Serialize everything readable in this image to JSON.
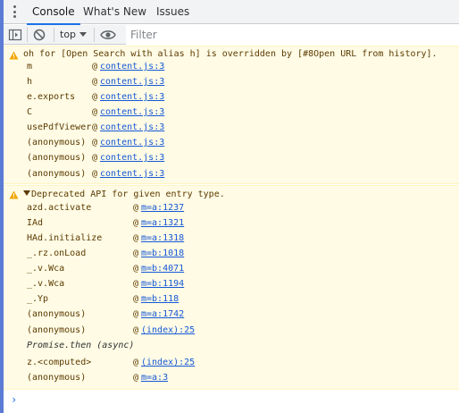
{
  "drawer": {
    "tabs": [
      {
        "label": "Console"
      },
      {
        "label": "What's New"
      },
      {
        "label": "Issues"
      }
    ]
  },
  "toolbar": {
    "context_label": "top",
    "filter_placeholder": "Filter"
  },
  "messages": [
    {
      "level": "warning",
      "text": "oh for [Open Search with alias h] is overridden by [#8Open URL from history].",
      "frames": [
        {
          "fn": "m",
          "at": "@",
          "link": "content.js:3"
        },
        {
          "fn": "h",
          "at": "@",
          "link": "content.js:3"
        },
        {
          "fn": "e.exports",
          "at": "@",
          "link": "content.js:3"
        },
        {
          "fn": "C",
          "at": "@",
          "link": "content.js:3"
        },
        {
          "fn": "usePdfViewer",
          "at": "@",
          "link": "content.js:3"
        },
        {
          "fn": "(anonymous)",
          "at": "@",
          "link": "content.js:3"
        },
        {
          "fn": "(anonymous)",
          "at": "@",
          "link": "content.js:3"
        },
        {
          "fn": "(anonymous)",
          "at": "@",
          "link": "content.js:3"
        }
      ]
    },
    {
      "level": "warning",
      "text": "Deprecated API for given entry type.",
      "frames": [
        {
          "fn": "azd.activate",
          "at": "@",
          "link": "m=a:1237"
        },
        {
          "fn": "IAd",
          "at": "@",
          "link": "m=a:1321"
        },
        {
          "fn": "HAd.initialize",
          "at": "@",
          "link": "m=a:1318"
        },
        {
          "fn": "_.rz.onLoad",
          "at": "@",
          "link": "m=b:1018"
        },
        {
          "fn": "_.v.Wca",
          "at": "@",
          "link": "m=b:4071"
        },
        {
          "fn": "_.v.Wca",
          "at": "@",
          "link": "m=b:1194"
        },
        {
          "fn": "_.Yp",
          "at": "@",
          "link": "m=b:118"
        },
        {
          "fn": "(anonymous)",
          "at": "@",
          "link": "m=a:1742"
        },
        {
          "fn": "(anonymous)",
          "at": "@",
          "link": "(index):25"
        }
      ],
      "async_label": "Promise.then (async)",
      "frames_after": [
        {
          "fn": "z.<computed>",
          "at": "@",
          "link": "(index):25"
        },
        {
          "fn": "(anonymous)",
          "at": "@",
          "link": "m=a:3"
        }
      ]
    }
  ],
  "prompt_symbol": "›",
  "colors": {
    "accent": "#1a73e8",
    "warning_bg": "#fffbe5",
    "warning_text": "#5c3b00",
    "link": "#1558d6"
  }
}
